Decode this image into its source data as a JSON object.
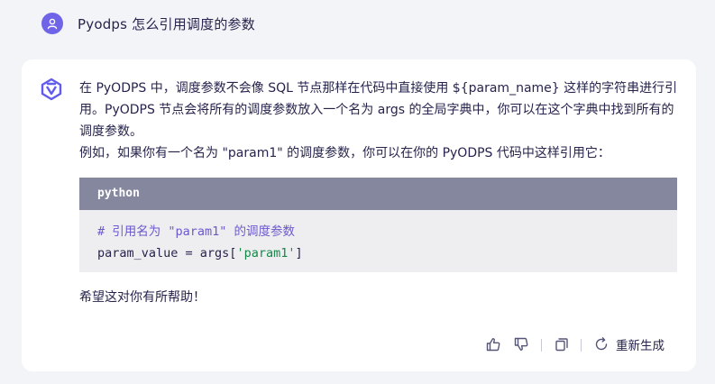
{
  "user": {
    "question": "Pyodps 怎么引用调度的参数",
    "avatar_icon": "user-icon"
  },
  "answer": {
    "logo_icon": "tongyi-logo-icon",
    "paragraph1": "在 PyODPS 中，调度参数不会像 SQL 节点那样在代码中直接使用 ${param_name} 这样的字符串进行引用。PyODPS 节点会将所有的调度参数放入一个名为 args 的全局字典中，你可以在这个字典中找到所有的调度参数。",
    "paragraph2": "例如，如果你有一个名为 \"param1\" 的调度参数，你可以在你的 PyODPS 代码中这样引用它：",
    "code": {
      "language": "python",
      "comment": "# 引用名为 \"param1\" 的调度参数",
      "line2_prefix": "param_value = args[",
      "line2_string": "'param1'",
      "line2_suffix": "]"
    },
    "closing": "希望这对你有所帮助！"
  },
  "actions": {
    "like_icon": "thumbs-up-icon",
    "dislike_icon": "thumbs-down-icon",
    "copy_icon": "copy-icon",
    "regenerate_icon": "refresh-icon",
    "regenerate_label": "重新生成"
  },
  "colors": {
    "accent": "#6f63e7",
    "code_header": "#85879f",
    "code_bg": "#eeeef0",
    "string": "#16894a",
    "comment": "#6a5acd"
  }
}
